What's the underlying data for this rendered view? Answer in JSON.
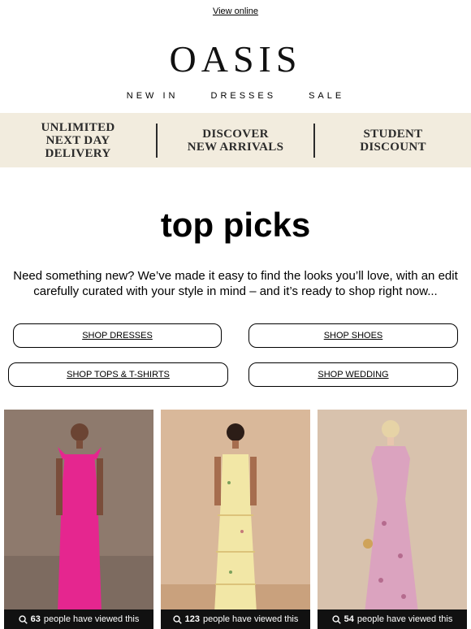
{
  "header": {
    "view_online": "View online",
    "logo": "OASIS"
  },
  "nav": {
    "items": [
      "NEW IN",
      "DRESSES",
      "SALE"
    ]
  },
  "promo": {
    "items": [
      "UNLIMITED NEXT DAY DELIVERY",
      "DISCOVER NEW ARRIVALS",
      "STUDENT DISCOUNT"
    ]
  },
  "main": {
    "heading": "top picks",
    "intro": "Need something new? We’ve made it easy to find the looks you’ll love, with an edit carefully curated with your style in mind – and it’s ready to shop right now...",
    "buttons": [
      "SHOP DRESSES",
      "SHOP SHOES",
      "SHOP TOPS & T-SHIRTS",
      "SHOP WEDDING"
    ]
  },
  "products": [
    {
      "count": "63",
      "suffix": "people have viewed this",
      "dress_color": "#e5268f",
      "bg_color": "#8e7a6d"
    },
    {
      "count": "123",
      "suffix": "people have viewed this",
      "dress_color": "#f2e7a6",
      "bg_color": "#d9b89a"
    },
    {
      "count": "54",
      "suffix": "people have viewed this",
      "dress_color": "#dba3bf",
      "bg_color": "#d8c2ad"
    }
  ],
  "colors": {
    "promo_bg": "#f2ecde",
    "text": "#000000",
    "counter_bg": "#111111"
  }
}
